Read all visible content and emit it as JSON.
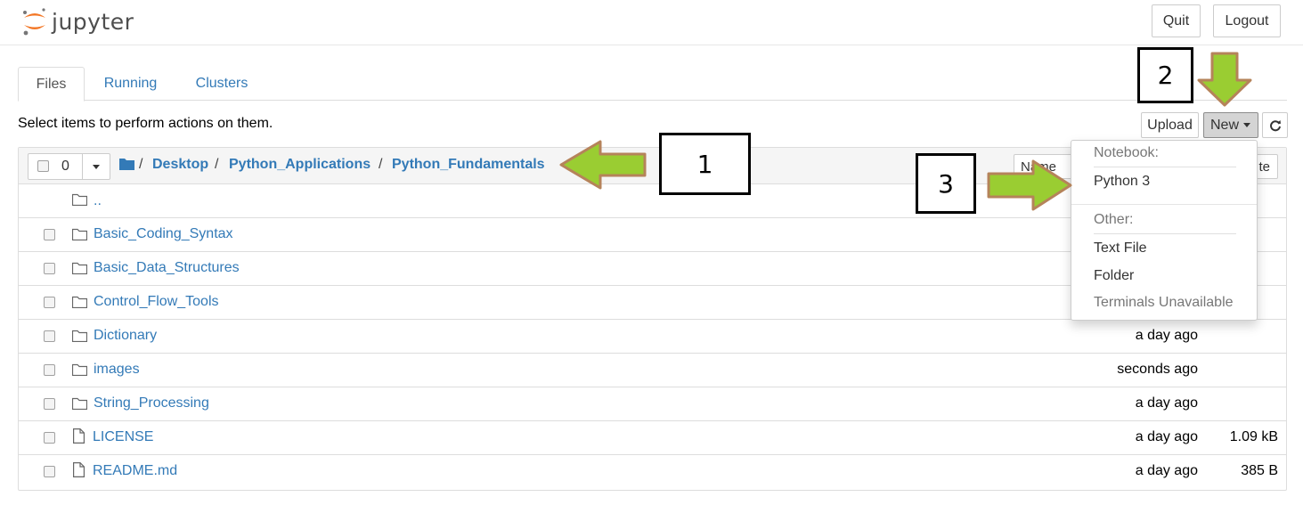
{
  "header": {
    "logo_text": "jupyter",
    "quit_label": "Quit",
    "logout_label": "Logout"
  },
  "tabs": [
    {
      "label": "Files",
      "active": true
    },
    {
      "label": "Running",
      "active": false
    },
    {
      "label": "Clusters",
      "active": false
    }
  ],
  "toolbar": {
    "hint": "Select items to perform actions on them.",
    "upload_label": "Upload",
    "new_label": "New"
  },
  "list_header": {
    "selected_count": "0",
    "breadcrumb_sep": "/",
    "breadcrumbs": [
      "Desktop",
      "Python_Applications",
      "Python_Fundamentals"
    ],
    "name_sort_label": "Name",
    "size_col_label": "te"
  },
  "files": [
    {
      "name": "..",
      "type": "parent",
      "modified": "",
      "size": ""
    },
    {
      "name": "Basic_Coding_Syntax",
      "type": "folder",
      "modified": "",
      "size": ""
    },
    {
      "name": "Basic_Data_Structures",
      "type": "folder",
      "modified": "",
      "size": ""
    },
    {
      "name": "Control_Flow_Tools",
      "type": "folder",
      "modified": "",
      "size": ""
    },
    {
      "name": "Dictionary",
      "type": "folder",
      "modified": "a day ago",
      "size": ""
    },
    {
      "name": "images",
      "type": "folder",
      "modified": "seconds ago",
      "size": ""
    },
    {
      "name": "String_Processing",
      "type": "folder",
      "modified": "a day ago",
      "size": ""
    },
    {
      "name": "LICENSE",
      "type": "file",
      "modified": "a day ago",
      "size": "1.09 kB"
    },
    {
      "name": "README.md",
      "type": "file",
      "modified": "a day ago",
      "size": "385 B"
    }
  ],
  "new_menu": {
    "notebook_header": "Notebook:",
    "python3": "Python 3",
    "other_header": "Other:",
    "text_file": "Text File",
    "folder": "Folder",
    "terminals": "Terminals Unavailable"
  },
  "annotations": {
    "box1": "1",
    "box2": "2",
    "box3": "3",
    "arrow_color": "#9acd32",
    "arrow_border": "#b5835a"
  },
  "colors": {
    "link": "#337ab7",
    "logo_orange": "#f37726"
  }
}
